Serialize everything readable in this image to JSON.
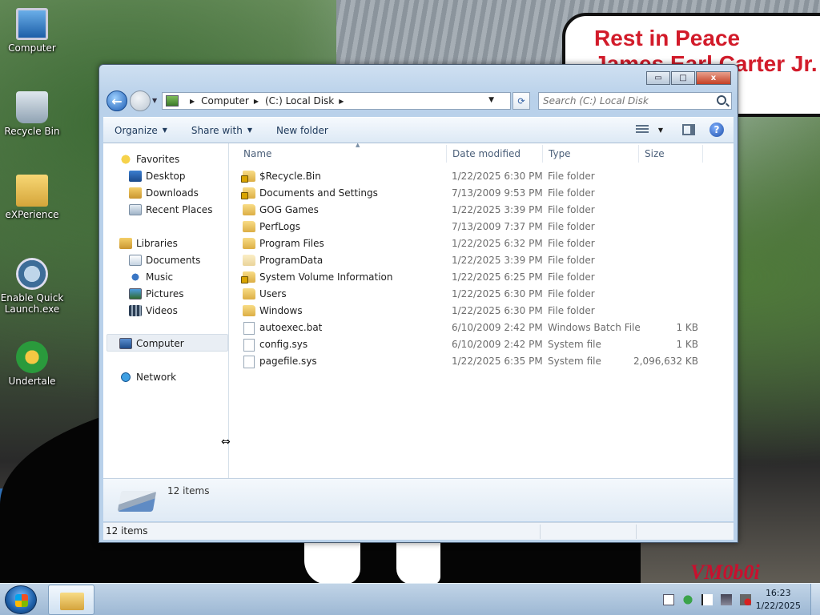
{
  "desktop": {
    "sign_line1": "Rest in Peace",
    "sign_line2": "James Earl Carter Jr.",
    "watermark": "VM0b0i",
    "icons": [
      {
        "label": "Computer",
        "icon": "computer-icon"
      },
      {
        "label": "Recycle Bin",
        "icon": "recycle-bin-icon"
      },
      {
        "label": "eXPerience",
        "icon": "folder-icon"
      },
      {
        "label": "Enable Quick Launch.exe",
        "icon": "aqua-icon"
      },
      {
        "label": "Undertale",
        "icon": "undertale-icon"
      }
    ]
  },
  "window": {
    "caption_buttons": {
      "minimize": "▭",
      "maximize": "□",
      "close": "x"
    },
    "address": {
      "crumbs": [
        "Computer",
        "(C:) Local Disk"
      ]
    },
    "search": {
      "placeholder": "Search (C:) Local Disk"
    },
    "toolbar": {
      "organize": "Organize",
      "share_with": "Share with",
      "new_folder": "New folder"
    },
    "nav_pane": {
      "favorites": "Favorites",
      "favorites_items": [
        "Desktop",
        "Downloads",
        "Recent Places"
      ],
      "libraries": "Libraries",
      "libraries_items": [
        "Documents",
        "Music",
        "Pictures",
        "Videos"
      ],
      "computer": "Computer",
      "network": "Network"
    },
    "columns": {
      "name": "Name",
      "date": "Date modified",
      "type": "Type",
      "size": "Size"
    },
    "files": [
      {
        "name": "$Recycle.Bin",
        "date": "1/22/2025 6:30 PM",
        "type": "File folder",
        "size": "",
        "icon": "locked-folder-icon"
      },
      {
        "name": "Documents and Settings",
        "date": "7/13/2009 9:53 PM",
        "type": "File folder",
        "size": "",
        "icon": "locked-folder-icon"
      },
      {
        "name": "GOG Games",
        "date": "1/22/2025 3:39 PM",
        "type": "File folder",
        "size": "",
        "icon": "folder-icon"
      },
      {
        "name": "PerfLogs",
        "date": "7/13/2009 7:37 PM",
        "type": "File folder",
        "size": "",
        "icon": "folder-icon"
      },
      {
        "name": "Program Files",
        "date": "1/22/2025 6:32 PM",
        "type": "File folder",
        "size": "",
        "icon": "folder-icon"
      },
      {
        "name": "ProgramData",
        "date": "1/22/2025 3:39 PM",
        "type": "File folder",
        "size": "",
        "icon": "hidden-folder-icon"
      },
      {
        "name": "System Volume Information",
        "date": "1/22/2025 6:25 PM",
        "type": "File folder",
        "size": "",
        "icon": "locked-folder-icon"
      },
      {
        "name": "Users",
        "date": "1/22/2025 6:30 PM",
        "type": "File folder",
        "size": "",
        "icon": "folder-icon"
      },
      {
        "name": "Windows",
        "date": "1/22/2025 6:30 PM",
        "type": "File folder",
        "size": "",
        "icon": "folder-icon"
      },
      {
        "name": "autoexec.bat",
        "date": "6/10/2009 2:42 PM",
        "type": "Windows Batch File",
        "size": "1 KB",
        "icon": "file-icon"
      },
      {
        "name": "config.sys",
        "date": "6/10/2009 2:42 PM",
        "type": "System file",
        "size": "1 KB",
        "icon": "file-icon"
      },
      {
        "name": "pagefile.sys",
        "date": "1/22/2025 6:35 PM",
        "type": "System file",
        "size": "2,096,632 KB",
        "icon": "file-icon"
      }
    ],
    "details": {
      "count": "12 items"
    },
    "status": {
      "count": "12 items"
    }
  },
  "taskbar": {
    "time": "16:23",
    "date": "1/22/2025"
  }
}
